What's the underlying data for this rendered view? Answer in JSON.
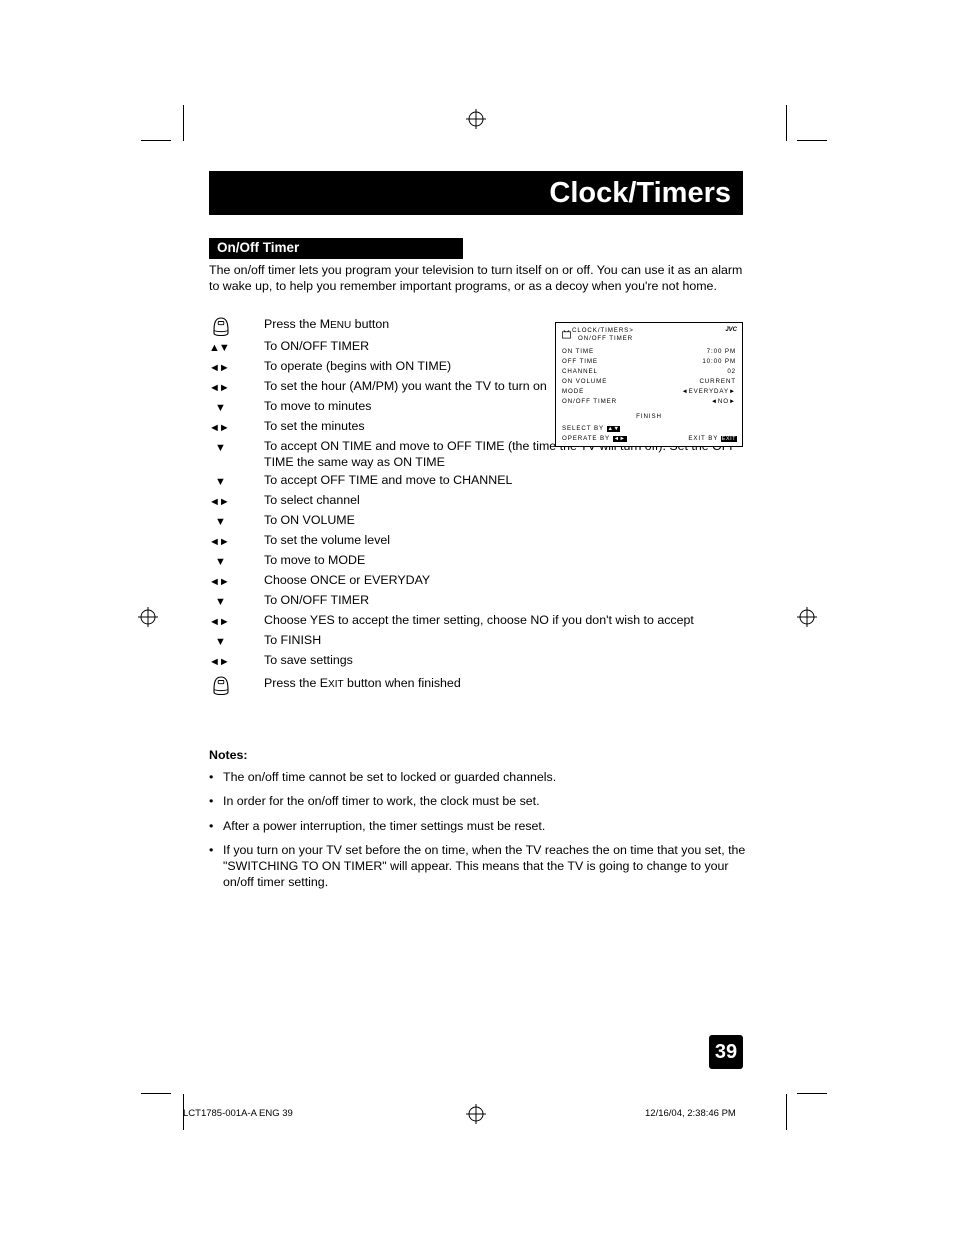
{
  "header": {
    "title": "Clock/Timers",
    "section": "On/Off Timer"
  },
  "intro": "The on/off timer lets you program your television to turn itself on or off. You can use it as an alarm to wake up, to help you remember important programs, or as a decoy when you're not home.",
  "steps": [
    {
      "symbol": "menu-button",
      "text_pre": "Press the M",
      "text_small": "ENU",
      "text_post": " button",
      "text": "Press the MENU button"
    },
    {
      "symbol": "up-down",
      "text": "To ON/OFF TIMER"
    },
    {
      "symbol": "left-right",
      "text": "To operate (begins with ON TIME)"
    },
    {
      "symbol": "left-right",
      "text": "To set the hour (AM/PM) you want the TV to turn on"
    },
    {
      "symbol": "down",
      "text": "To move to minutes"
    },
    {
      "symbol": "left-right",
      "text": "To set the minutes"
    },
    {
      "symbol": "down",
      "text": "To accept ON TIME and move to OFF TIME (the time the TV will turn off). Set the OFF TIME the same way as ON TIME"
    },
    {
      "symbol": "down",
      "text": "To accept OFF TIME and move to CHANNEL"
    },
    {
      "symbol": "left-right",
      "text": "To select channel"
    },
    {
      "symbol": "down",
      "text": "To ON VOLUME"
    },
    {
      "symbol": "left-right",
      "text": "To set the volume level"
    },
    {
      "symbol": "down",
      "text": "To move to MODE"
    },
    {
      "symbol": "left-right",
      "text": "Choose ONCE or EVERYDAY"
    },
    {
      "symbol": "down",
      "text": "To ON/OFF TIMER"
    },
    {
      "symbol": "left-right",
      "text": "Choose YES to accept the timer setting, choose NO if you don't wish to accept"
    },
    {
      "symbol": "down",
      "text": "To FINISH"
    },
    {
      "symbol": "left-right",
      "text": "To save settings"
    },
    {
      "symbol": "exit-button",
      "text_pre": "Press the E",
      "text_small": "XIT",
      "text_post": " button when finished",
      "text": "Press the EXIT button when finished"
    }
  ],
  "osd": {
    "brand": "JVC",
    "title": "CLOCK/TIMERS>",
    "subtitle": "ON/OFF TIMER",
    "rows": [
      {
        "label": "ON TIME",
        "value": "7:00 PM"
      },
      {
        "label": "OFF TIME",
        "value": "10:00 PM"
      },
      {
        "label": "CHANNEL",
        "value": "02"
      },
      {
        "label": "ON VOLUME",
        "value": "CURRENT"
      },
      {
        "label": "MODE",
        "value": "◄EVERYDAY►"
      },
      {
        "label": "ON/OFF TIMER",
        "value": "◄NO►"
      }
    ],
    "finish": "FINISH",
    "select_by": "SELECT  BY",
    "operate_by": "OPERATE BY",
    "exit_by": "EXIT BY",
    "exit_key": "EXIT"
  },
  "notes": {
    "title": "Notes:",
    "items": [
      "The on/off time cannot be set to locked or guarded channels.",
      "In order for the on/off timer to work, the clock must be set.",
      "After a power interruption, the timer settings must be reset.",
      "If you turn on your TV set before the on time, when the TV reaches the on time that you set, the \"SWITCHING TO ON TIMER\" will appear.  This means that the TV is going to change to your on/off timer setting."
    ]
  },
  "page_number": "39",
  "footer": {
    "left": "LCT1785-001A-A ENG   39",
    "right": "12/16/04, 2:38:46 PM"
  }
}
